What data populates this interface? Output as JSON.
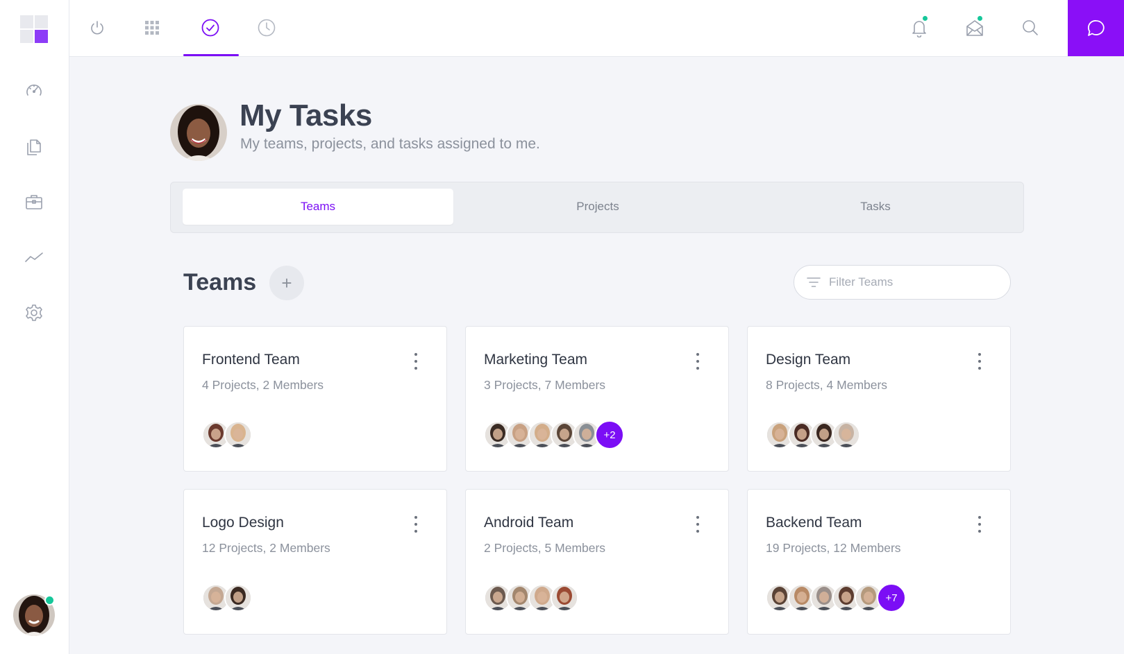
{
  "sidebar": {
    "items": [
      {
        "name": "dashboard",
        "icon": "speedometer-icon"
      },
      {
        "name": "documents",
        "icon": "documents-icon"
      },
      {
        "name": "briefcase",
        "icon": "briefcase-icon"
      },
      {
        "name": "analytics",
        "icon": "trend-line-icon"
      },
      {
        "name": "settings",
        "icon": "gear-icon"
      }
    ],
    "user_status": "online"
  },
  "topbar": {
    "nav": [
      {
        "name": "power",
        "icon": "power-icon"
      },
      {
        "name": "apps",
        "icon": "grid-icon"
      },
      {
        "name": "tasks",
        "icon": "check-circle-icon",
        "active": true
      },
      {
        "name": "history",
        "icon": "clock-icon"
      }
    ],
    "actions": [
      {
        "name": "notifications",
        "icon": "bell-icon",
        "badge": true
      },
      {
        "name": "messages",
        "icon": "mail-open-icon",
        "badge": true
      },
      {
        "name": "search",
        "icon": "search-icon"
      }
    ],
    "chat_icon": "chat-bubble-icon"
  },
  "header": {
    "title": "My Tasks",
    "subtitle": "My teams, projects, and tasks assigned to me."
  },
  "tabs": [
    {
      "label": "Teams",
      "active": true
    },
    {
      "label": "Projects",
      "active": false
    },
    {
      "label": "Tasks",
      "active": false
    }
  ],
  "section": {
    "title": "Teams",
    "add_label": "+",
    "filter_placeholder": "Filter Teams"
  },
  "teams": [
    {
      "name": "Frontend Team",
      "meta": "4 Projects, 2 Members",
      "avatars": [
        "#6b3a2e",
        "#d9b48f"
      ],
      "more": ""
    },
    {
      "name": "Marketing Team",
      "meta": "3 Projects, 7 Members",
      "avatars": [
        "#3a2b24",
        "#c8a184",
        "#d3ad8a",
        "#5b4638",
        "#8a8f95"
      ],
      "more": "+2"
    },
    {
      "name": "Design Team",
      "meta": "8 Projects, 4 Members",
      "avatars": [
        "#c9a27d",
        "#4a2b24",
        "#3a2720",
        "#c7b3a3"
      ],
      "more": ""
    },
    {
      "name": "Logo Design",
      "meta": "12 Projects, 2 Members",
      "avatars": [
        "#c4a893",
        "#3b2a22"
      ],
      "more": ""
    },
    {
      "name": "Android Team",
      "meta": "2 Projects, 5 Members",
      "avatars": [
        "#6c5a4f",
        "#a3876e",
        "#cfa98c",
        "#9b4a33"
      ],
      "more": ""
    },
    {
      "name": "Backend Team",
      "meta": "19 Projects, 12 Members",
      "avatars": [
        "#5a4336",
        "#b88a66",
        "#9a8f8a",
        "#5d3d30",
        "#b59a7d"
      ],
      "more": "+7"
    }
  ],
  "colors": {
    "accent": "#7b0ef5",
    "online": "#16c79a",
    "background": "#f4f5f9"
  }
}
